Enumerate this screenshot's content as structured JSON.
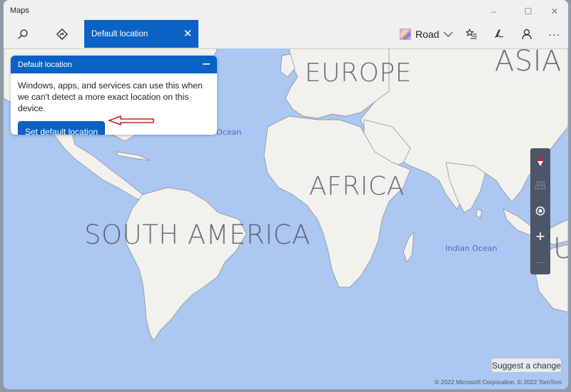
{
  "app": {
    "title": "Maps"
  },
  "window_controls": {
    "minimize": "–",
    "maximize": "☐",
    "close": "✕"
  },
  "toolbar": {
    "search_icon": "search-icon",
    "directions_icon": "directions-icon",
    "active_tab": {
      "label": "Default location",
      "close_glyph": "✕"
    },
    "map_style": {
      "label": "Road",
      "chevron": "⌵"
    },
    "favorites_icon": "favorites-icon",
    "ink_icon": "ink-icon",
    "account_icon": "account-icon",
    "more_glyph": "···"
  },
  "panel": {
    "title": "Default location",
    "minimize_glyph": "—",
    "description": "Windows, apps, and services can use this when we can't detect a more exact location on this device.",
    "button_label": "Set default location"
  },
  "map": {
    "continents": [
      "EUROPE",
      "ASIA",
      "AFRICA",
      "SOUTH AMERICA"
    ],
    "oceans": [
      "Ocean",
      "Indian Ocean"
    ],
    "partial_label": "U",
    "colors": {
      "water": "#abc7f2",
      "land": "#f2f1ee",
      "accent": "#0a62c4"
    }
  },
  "map_controls": {
    "compass": "compass-icon",
    "tilt": "tilt-icon",
    "locate": "locate-icon",
    "zoom_in": "+",
    "zoom_out": "—"
  },
  "footer": {
    "suggest_label": "Suggest a change",
    "copyright": "© 2022 Microsoft Corporation, © 2022 TomTom"
  }
}
